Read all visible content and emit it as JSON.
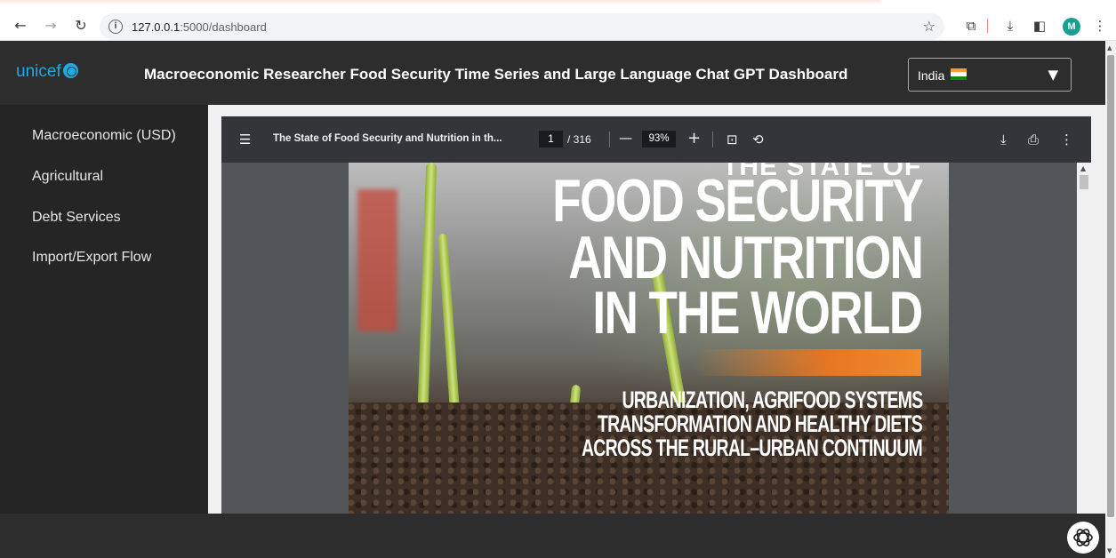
{
  "browser": {
    "url_host": "127.0.0.1",
    "url_path": ":5000/dashboard",
    "avatar_letter": "M"
  },
  "header": {
    "logo_text": "unicef",
    "title": "Macroeconomic Researcher Food Security Time Series and Large Language Chat GPT Dashboard",
    "country_selected": "India"
  },
  "sidebar": {
    "items": [
      {
        "label": "Macroeconomic (USD)"
      },
      {
        "label": "Agricultural"
      },
      {
        "label": "Debt Services"
      },
      {
        "label": "Import/Export Flow"
      }
    ]
  },
  "pdf_viewer": {
    "doc_title": "The State of Food Security and Nutrition in th...",
    "current_page": "1",
    "total_pages": "/ 316",
    "zoom": "93%",
    "cover": {
      "top_cut": "THE STATE OF",
      "title_line1": "FOOD SECURITY",
      "title_line2": "AND NUTRITION",
      "title_line3": "IN THE WORLD",
      "subtitle_line1": "URBANIZATION, AGRIFOOD SYSTEMS",
      "subtitle_line2": "TRANSFORMATION AND HEALTHY DIETS",
      "subtitle_line3": "ACROSS THE RURAL–URBAN CONTINUUM"
    }
  },
  "colors": {
    "unicef_blue": "#1cabe2",
    "header_bg": "#2d2d2d",
    "sidebar_bg": "#252525",
    "pdf_toolbar_bg": "#323639",
    "orange_accent": "#e87722"
  }
}
